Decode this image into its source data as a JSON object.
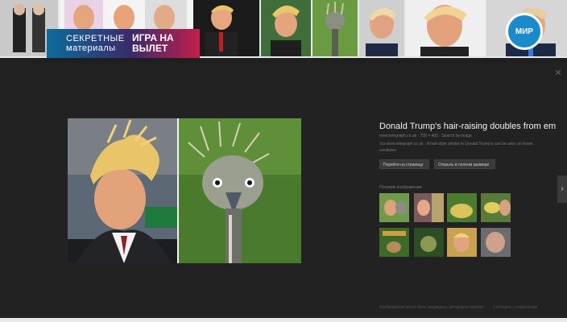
{
  "banner": {
    "left": "СЕКРЕТНЫЕ материалы",
    "right": "ИГРА НА ВЫЛЕТ"
  },
  "logo": {
    "text": "МИР"
  },
  "detail": {
    "title": "Donald Trump's hair-raising doubles from em...",
    "meta": "www.telegraph.co.uk · 728 × 400 · Search by image",
    "description": "Via www.telegraph.co.uk · A hair-style similar to Donald Trump's can be seen on these creatures",
    "buttons": [
      {
        "label": "Перейти на страницу"
      },
      {
        "label": "Открыть в полном размере"
      }
    ],
    "related_label": "Похожие изображения",
    "footer_left": "Изображения могут быть защищены авторским правом.",
    "footer_right": "Сообщить о нарушении"
  },
  "colors": {
    "panel_bg": "#222222",
    "strip_bg": "#e9e9e9",
    "accent": "#4a90e2"
  },
  "icons": {
    "close": "close-icon",
    "next": "chevron-right-icon"
  }
}
